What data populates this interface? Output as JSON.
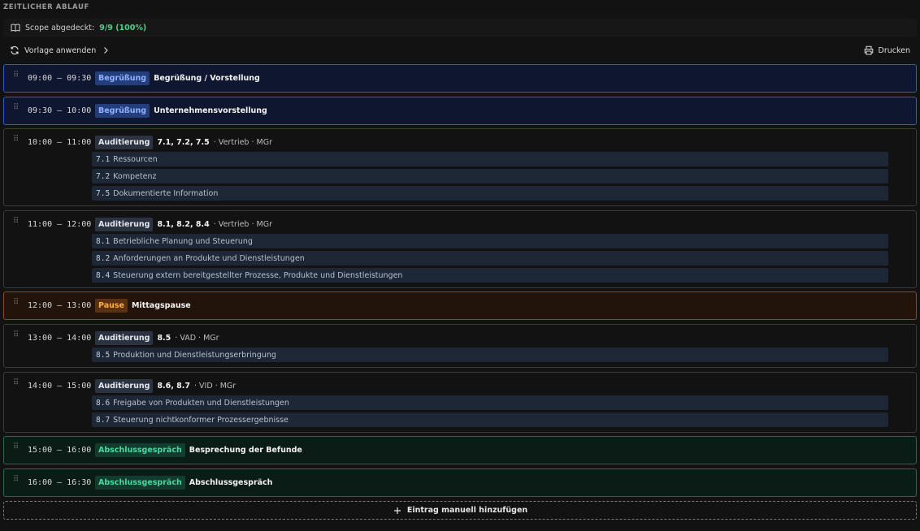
{
  "section": {
    "title": "ZEITLICHER ABLAUF"
  },
  "scope": {
    "label": "Scope abgedeckt:",
    "value": "9/9 (100%)"
  },
  "toolbar": {
    "template_label": "Vorlage anwenden",
    "print_label": "Drucken"
  },
  "entries": [
    {
      "time": "09:00 – 09:30",
      "badge": "Begrüßung",
      "title": "Begrüßung / Vorstellung",
      "meta": "",
      "subitems": []
    },
    {
      "time": "09:30 – 10:00",
      "badge": "Begrüßung",
      "title": "Unternehmensvorstellung",
      "meta": "",
      "subitems": []
    },
    {
      "time": "10:00 – 11:00",
      "badge": "Auditierung",
      "title": "7.1, 7.2, 7.5",
      "meta": "· Vertrieb · MGr",
      "subitems": [
        {
          "num": "7.1",
          "label": "Ressourcen"
        },
        {
          "num": "7.2",
          "label": "Kompetenz"
        },
        {
          "num": "7.5",
          "label": "Dokumentierte Information"
        }
      ]
    },
    {
      "time": "11:00 – 12:00",
      "badge": "Auditierung",
      "title": "8.1, 8.2, 8.4",
      "meta": "· Vertrieb · MGr",
      "subitems": [
        {
          "num": "8.1",
          "label": "Betriebliche Planung und Steuerung"
        },
        {
          "num": "8.2",
          "label": "Anforderungen an Produkte und Dienstleistungen"
        },
        {
          "num": "8.4",
          "label": "Steuerung extern bereitgestellter Prozesse, Produkte und Dienstleistungen"
        }
      ]
    },
    {
      "time": "12:00 – 13:00",
      "badge": "Pause",
      "title": "Mittagspause",
      "meta": "",
      "subitems": []
    },
    {
      "time": "13:00 – 14:00",
      "badge": "Auditierung",
      "title": "8.5",
      "meta": "· VAD · MGr",
      "subitems": [
        {
          "num": "8.5",
          "label": "Produktion und Dienstleistungserbringung"
        }
      ]
    },
    {
      "time": "14:00 – 15:00",
      "badge": "Auditierung",
      "title": "8.6, 8.7",
      "meta": "· VID · MGr",
      "subitems": [
        {
          "num": "8.6",
          "label": "Freigabe von Produkten und Dienstleistungen"
        },
        {
          "num": "8.7",
          "label": "Steuerung nichtkonformer Prozessergebnisse"
        }
      ]
    },
    {
      "time": "15:00 – 16:00",
      "badge": "Abschlussgespräch",
      "title": "Besprechung der Befunde",
      "meta": "",
      "subitems": []
    },
    {
      "time": "16:00 – 16:30",
      "badge": "Abschlussgespräch",
      "title": "Abschlussgespräch",
      "meta": "",
      "subitems": []
    }
  ],
  "add_entry": {
    "label": "Eintrag manuell hinzufügen"
  },
  "colors": {
    "begruessung": "#3557c8",
    "pause": "#8a4a1f",
    "abschluss": "#1e6a52",
    "scope_ok": "#4fd18a"
  }
}
